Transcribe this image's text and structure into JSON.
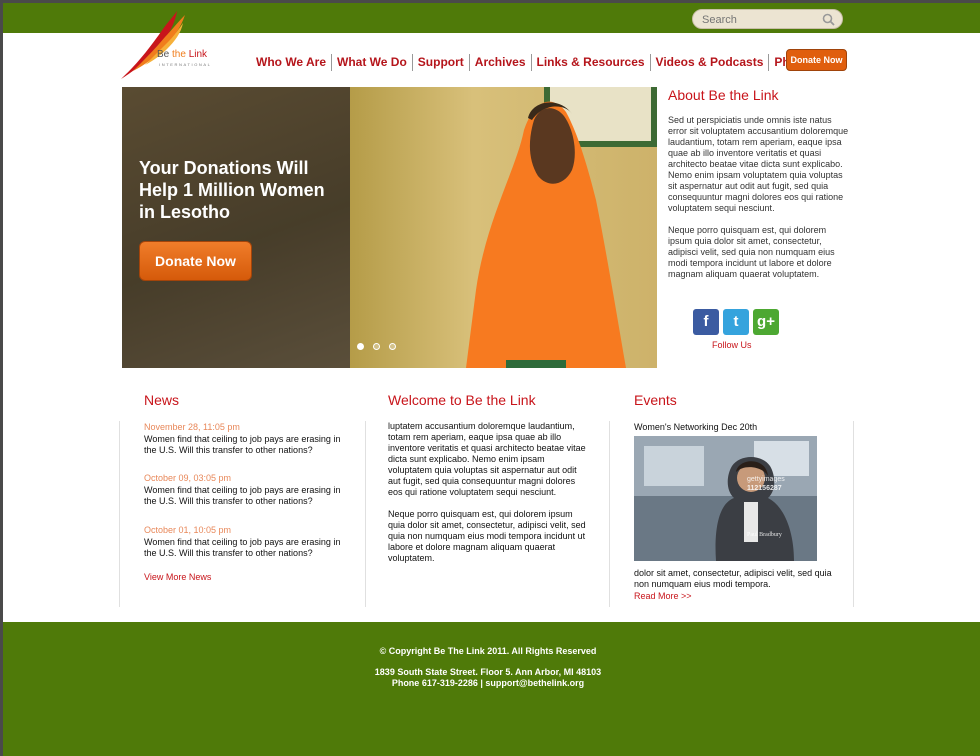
{
  "header": {
    "search_placeholder": "Search",
    "logo": {
      "be": "Be",
      "the": " the ",
      "link": "Link",
      "sub": "INTERNATIONAL"
    },
    "nav": [
      "Who We Are",
      "What We Do",
      "Support",
      "Archives",
      "Links & Resources",
      "Videos & Podcasts",
      "Photos"
    ],
    "donate_label": "Donate Now"
  },
  "hero": {
    "title": "Your Donations Will Help 1 Million Women in Lesotho",
    "donate_label": "Donate Now",
    "slides": 3,
    "active_slide": 1
  },
  "about": {
    "title": "About Be the Link",
    "p1": "Sed ut perspiciatis unde omnis iste natus error sit voluptatem accusantium doloremque laudantium, totam rem aperiam, eaque ipsa quae ab illo inventore veritatis et quasi architecto beatae vitae dicta sunt explicabo. Nemo enim ipsam voluptatem quia voluptas sit aspernatur aut odit aut fugit, sed quia consequuntur magni dolores eos qui ratione voluptatem sequi nesciunt.",
    "p2": "Neque porro quisquam est, qui dolorem ipsum quia dolor sit amet, consectetur, adipisci velit, sed quia non numquam eius modi tempora incidunt ut labore et dolore magnam aliquam quaerat voluptatem.",
    "follow": "Follow Us",
    "social_icons": [
      "facebook-icon",
      "twitter-icon",
      "google-plus-icon"
    ]
  },
  "news": {
    "title": "News",
    "items": [
      {
        "date": "November 28, 11:05 pm",
        "text": "Women find that ceiling to job pays are erasing in the U.S. Will this transfer to other nations?"
      },
      {
        "date": "October 09, 03:05 pm",
        "text": "Women find that ceiling to job pays are erasing in the U.S. Will this transfer to other nations?"
      },
      {
        "date": "October 01, 10:05 pm",
        "text": "Women find that ceiling to job pays are erasing in the U.S. Will this transfer to other nations?"
      }
    ],
    "view_more": "View More News"
  },
  "welcome": {
    "title": "Welcome to Be the Link",
    "p1": "luptatem accusantium doloremque laudantium, totam rem aperiam, eaque ipsa quae ab illo inventore veritatis et quasi architecto beatae vitae dicta sunt explicabo. Nemo enim ipsam voluptatem quia voluptas sit aspernatur aut odit aut fugit, sed quia consequuntur magni dolores eos qui ratione voluptatem sequi nesciunt.",
    "p2": "Neque porro quisquam est, qui dolorem ipsum quia dolor sit amet, consectetur, adipisci velit, sed quia non numquam eius modi tempora incidunt ut labore et dolore magnam aliquam quaerat voluptatem."
  },
  "events": {
    "title": "Events",
    "event_title": "Women's Networking  Dec 20th",
    "text": "dolor sit amet, consectetur, adipisci velit, sed quia non numquam eius modi tempora.",
    "read_more": "Read More >>",
    "image_watermark": "gettyimages",
    "image_number": "112156287",
    "image_credit": "Paul Bradbury"
  },
  "footer": {
    "copyright": "© Copyright Be The Link 2011. All Rights Reserved",
    "address": "1839 South State Street. Floor 5. Ann Arbor, MI 48103",
    "contact": "Phone 617-319-2286 | support@bethelink.org"
  },
  "colors": {
    "brand_green": "#4f7a09",
    "brand_red": "#c8151b",
    "accent_orange": "#e05e0d",
    "date_orange": "#e8885a"
  }
}
